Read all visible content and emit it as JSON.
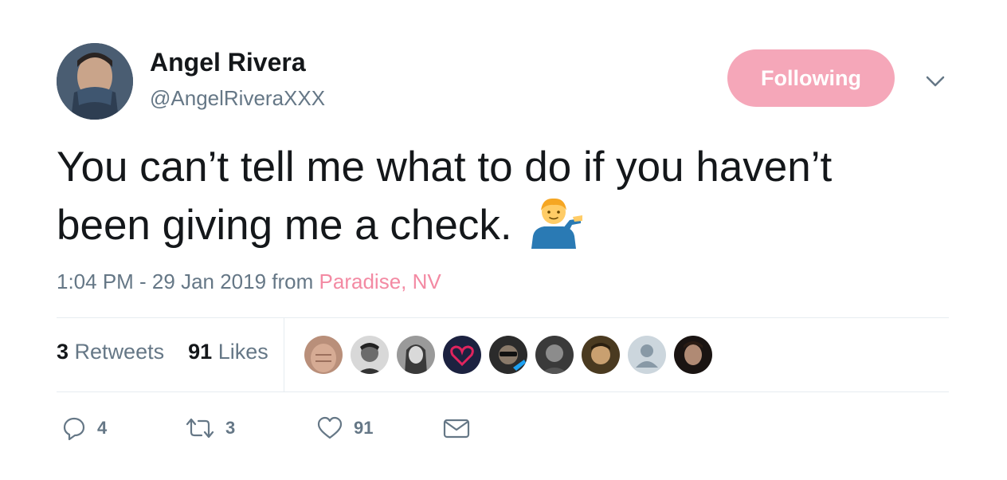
{
  "author": {
    "name": "Angel Rivera",
    "handle": "@AngelRiveraXXX"
  },
  "follow_button": {
    "label": "Following",
    "color": "#f5a7b9"
  },
  "tweet": {
    "text_line1": "You can’t tell me what to do if you haven’t",
    "text_line2": "been giving me a check.",
    "emoji": "man-tipping-hand-emoji"
  },
  "meta": {
    "timestamp": "1:04 PM - 29 Jan 2019",
    "from_word": "from",
    "location": "Paradise, NV",
    "location_color": "#f38aa3"
  },
  "stats": {
    "retweets_count": "3",
    "retweets_label": "Retweets",
    "likes_count": "91",
    "likes_label": "Likes"
  },
  "likers": [
    {
      "icon": "liker-avatar-1"
    },
    {
      "icon": "liker-avatar-2"
    },
    {
      "icon": "liker-avatar-3"
    },
    {
      "icon": "liker-avatar-4"
    },
    {
      "icon": "liker-avatar-5"
    },
    {
      "icon": "liker-avatar-6"
    },
    {
      "icon": "liker-avatar-7"
    },
    {
      "icon": "liker-avatar-8"
    },
    {
      "icon": "liker-avatar-9"
    }
  ],
  "actions": {
    "reply_count": "4",
    "retweet_count": "3",
    "like_count": "91"
  }
}
